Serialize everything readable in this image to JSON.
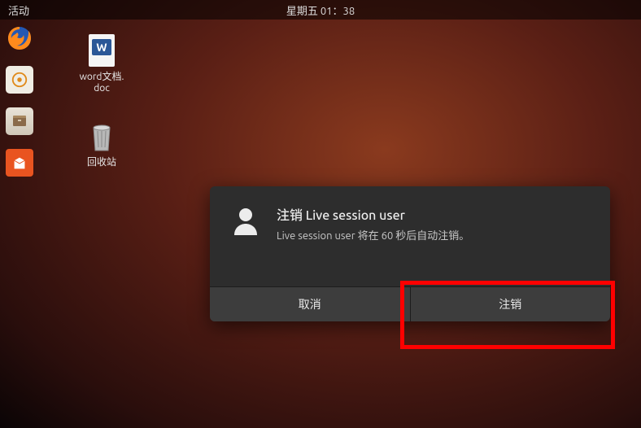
{
  "topbar": {
    "activities": "活动",
    "clock": "星期五 01：38"
  },
  "dock": {
    "items": [
      "firefox",
      "rhythmbox",
      "files",
      "software"
    ]
  },
  "desktop": {
    "icons": [
      {
        "label": "word文档.\ndoc",
        "kind": "word-doc"
      },
      {
        "label": "回收站",
        "kind": "trash"
      }
    ]
  },
  "dialog": {
    "title": "注销 Live session user",
    "subtitle": "Live session user 将在 60 秒后自动注销。",
    "buttons": {
      "cancel": "取消",
      "logout": "注销"
    }
  }
}
